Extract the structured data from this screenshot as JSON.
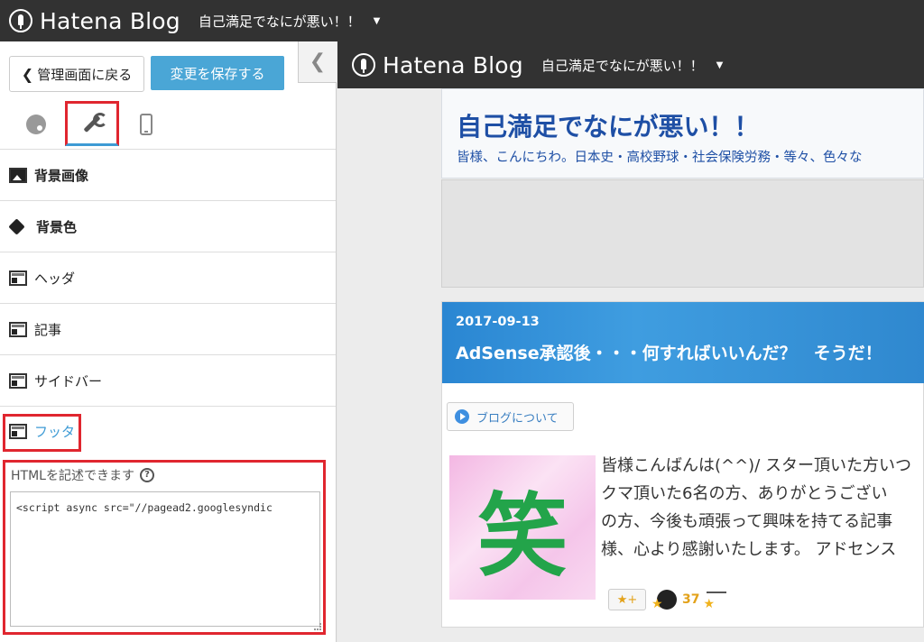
{
  "topbar": {
    "logo": "Hatena Blog",
    "blog_name": "自己満足でなにが悪い！！",
    "caret": "▼"
  },
  "panel": {
    "back_label": "管理画面に戻る",
    "back_chevron": "❮",
    "save_label": "変更を保存する",
    "collapse_icon": "❮",
    "tabs": [
      "palette-icon",
      "wrench-icon",
      "smartphone-icon"
    ],
    "menu": {
      "bg_image": "背景画像",
      "bg_color": "背景色",
      "header": "ヘッダ",
      "article": "記事",
      "sidebar": "サイドバー",
      "footer": "フッタ"
    },
    "html_label": "HTMLを記述できます",
    "help_icon": "?",
    "code": "<script async src=\"//pagead2.googlesyndic"
  },
  "preview": {
    "logo": "Hatena Blog",
    "blog_name": "自己満足でなにが悪い！！",
    "caret": "▼",
    "title": "自己満足でなにが悪い！！",
    "description": "皆様、こんにちわ。日本史・高校野球・社会保険労務・等々、色々な",
    "date": "2017-09-13",
    "article_title": "AdSense承認後・・・何すればいいんだ？　そうだ！",
    "about_link": "ブログについて",
    "thumb_char": "笑",
    "body_lines": [
      "皆様こんばんは(^^)/ スター頂いた方いつ",
      "クマ頂いた6名の方、ありがとうござい",
      "の方、今後も頑張って興味を持てる記事",
      "様、心より感謝いたします。 アドセンス"
    ],
    "star_button": "★+",
    "star_count": "37"
  },
  "colors": {
    "accent": "#4aa6d6",
    "highlight": "#e0262f",
    "title_blue": "#1e4fa5"
  }
}
